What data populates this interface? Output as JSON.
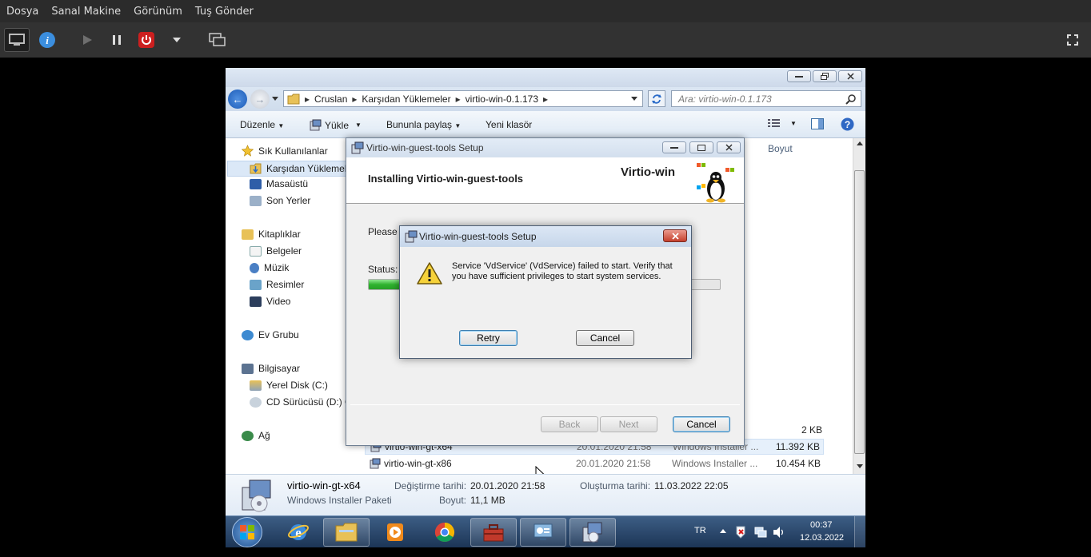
{
  "host_menu": [
    "Dosya",
    "Sanal Makine",
    "Görünüm",
    "Tuş Gönder"
  ],
  "host_toolbar": {
    "icons": [
      "monitor-icon",
      "info-icon",
      "play-icon",
      "pause-icon",
      "power-icon",
      "chevron-down-icon",
      "screens-icon",
      "fullscreen-icon"
    ]
  },
  "explorer": {
    "breadcrumb": [
      "Cruslan",
      "Karşıdan Yüklemeler",
      "virtio-win-0.1.173"
    ],
    "search_placeholder": "Ara: virtio-win-0.1.173",
    "commands": {
      "organize": "Düzenle",
      "install": "Yükle",
      "share": "Bununla paylaş",
      "new_folder": "Yeni klasör"
    },
    "nav": {
      "favorites": "Sık Kullanılanlar",
      "downloads": "Karşıdan Yüklemeler",
      "desktop": "Masaüstü",
      "recent": "Son Yerler",
      "libraries": "Kitaplıklar",
      "documents": "Belgeler",
      "music": "Müzik",
      "pictures": "Resimler",
      "videos": "Video",
      "homegroup": "Ev Grubu",
      "computer": "Bilgisayar",
      "local_disk": "Yerel Disk (C:)",
      "cd_drive": "CD Sürücüsü (D:) G",
      "network": "Ağ"
    },
    "column_size": "Boyut",
    "partial_size": "2 KB",
    "files": [
      {
        "name": "virtio-win-gt-x64",
        "date": "20.01.2020 21:58",
        "type": "Windows Installer ...",
        "size": "11.392 KB"
      },
      {
        "name": "virtio-win-gt-x86",
        "date": "20.01.2020 21:58",
        "type": "Windows Installer ...",
        "size": "10.454 KB"
      }
    ],
    "details": {
      "name": "virtio-win-gt-x64",
      "type": "Windows Installer Paketi",
      "modified_label": "Değiştirme tarihi:",
      "modified_value": "20.01.2020 21:58",
      "created_label": "Oluşturma tarihi:",
      "created_value": "11.03.2022 22:05",
      "size_label": "Boyut:",
      "size_value": "11,1 MB"
    }
  },
  "setup": {
    "title": "Virtio-win-guest-tools Setup",
    "heading": "Installing Virtio-win-guest-tools",
    "brand": "Virtio-win",
    "please_wait": "Please w",
    "status_label": "Status:",
    "progress": 0.1,
    "back": "Back",
    "next": "Next",
    "cancel": "Cancel"
  },
  "error_dialog": {
    "title": "Virtio-win-guest-tools Setup",
    "message": "Service 'VdService' (VdService) failed to start.  Verify that you have sufficient privileges to start system services.",
    "retry": "Retry",
    "cancel": "Cancel"
  },
  "taskbar": {
    "language": "TR",
    "time": "00:37",
    "date": "12.03.2022"
  },
  "colors": {
    "accent": "#3c7fb1",
    "progress": "#2fb32f",
    "power": "#cc1f1f"
  }
}
